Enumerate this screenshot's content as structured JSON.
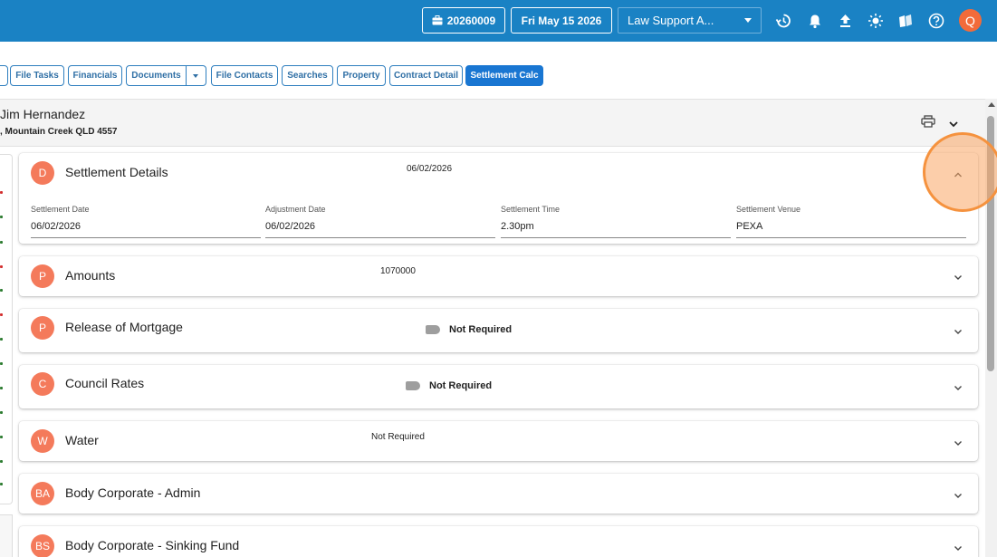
{
  "topbar": {
    "matter_number": "20260009",
    "date": "Fri May 15 2026",
    "workspace_select": "Law Support A...",
    "avatar_initial": "Q",
    "icons": [
      "briefcase-icon",
      "history-icon",
      "bell-icon",
      "upload-icon",
      "brightness-icon",
      "book-icon",
      "help-icon"
    ]
  },
  "tabs": [
    {
      "label": "File Tasks"
    },
    {
      "label": "Financials"
    },
    {
      "label": "Documents"
    },
    {
      "label": "File Contacts"
    },
    {
      "label": "Searches"
    },
    {
      "label": "Property"
    },
    {
      "label": "Contract Detail"
    },
    {
      "label": "Settlement Calc",
      "active": true
    }
  ],
  "header": {
    "client_name": "Jim Hernandez",
    "address": ", Mountain Creek QLD 4557"
  },
  "cards": [
    {
      "avatar": "D",
      "title": "Settlement Details",
      "summary": "06/02/2026",
      "fields": [
        {
          "label": "Settlement Date",
          "value": "06/02/2026"
        },
        {
          "label": "Adjustment Date",
          "value": "06/02/2026"
        },
        {
          "label": "Settlement Time",
          "value": "2.30pm"
        },
        {
          "label": "Settlement Venue",
          "value": "PEXA"
        }
      ]
    },
    {
      "avatar": "P",
      "title": "Amounts",
      "summary": "1070000"
    },
    {
      "avatar": "P",
      "title": "Release of Mortgage",
      "status": "Not Required"
    },
    {
      "avatar": "C",
      "title": "Council Rates",
      "status": "Not Required"
    },
    {
      "avatar": "W",
      "title": "Water",
      "summary": "Not Required"
    },
    {
      "avatar": "BA",
      "title": "Body Corporate - Admin"
    },
    {
      "avatar": "BS",
      "title": "Body Corporate - Sinking Fund"
    }
  ],
  "colors": {
    "topbar": "#1a82c4",
    "tab_active": "#1976d2",
    "card_avatar": "#f47a5b",
    "highlight": "#f5923e"
  }
}
